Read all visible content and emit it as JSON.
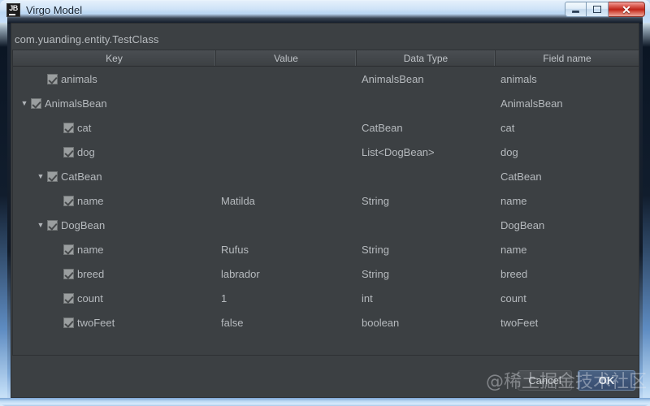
{
  "window": {
    "title": "Virgo Model",
    "app_icon": "jetbrains-jb-icon",
    "controls": {
      "minimize": "minimize-icon",
      "maximize": "maximize-icon",
      "close_glyph": "✕"
    }
  },
  "dialog": {
    "class_name": "com.yuanding.entity.TestClass",
    "table": {
      "columns": [
        "Key",
        "Value",
        "Data Type",
        "Field name"
      ],
      "rows": [
        {
          "indent": 1,
          "toggle": "",
          "checked": true,
          "key": "animals",
          "value": "",
          "type": "AnimalsBean",
          "field": "animals"
        },
        {
          "indent": 0,
          "toggle": "▼",
          "checked": true,
          "key": "AnimalsBean",
          "value": "",
          "type": "",
          "field": "AnimalsBean"
        },
        {
          "indent": 2,
          "toggle": "",
          "checked": true,
          "key": "cat",
          "value": "",
          "type": "CatBean",
          "field": "cat"
        },
        {
          "indent": 2,
          "toggle": "",
          "checked": true,
          "key": "dog",
          "value": "",
          "type": "List<DogBean>",
          "field": "dog"
        },
        {
          "indent": 1,
          "toggle": "▼",
          "checked": true,
          "key": "CatBean",
          "value": "",
          "type": "",
          "field": "CatBean"
        },
        {
          "indent": 2,
          "toggle": "",
          "checked": true,
          "key": "name",
          "value": "Matilda",
          "type": "String",
          "field": "name"
        },
        {
          "indent": 1,
          "toggle": "▼",
          "checked": true,
          "key": "DogBean",
          "value": "",
          "type": "",
          "field": "DogBean"
        },
        {
          "indent": 2,
          "toggle": "",
          "checked": true,
          "key": "name",
          "value": "Rufus",
          "type": "String",
          "field": "name"
        },
        {
          "indent": 2,
          "toggle": "",
          "checked": true,
          "key": "breed",
          "value": "labrador",
          "type": "String",
          "field": "breed"
        },
        {
          "indent": 2,
          "toggle": "",
          "checked": true,
          "key": "count",
          "value": "1",
          "type": "int",
          "field": "count"
        },
        {
          "indent": 2,
          "toggle": "",
          "checked": true,
          "key": "twoFeet",
          "value": "false",
          "type": "boolean",
          "field": "twoFeet"
        }
      ]
    },
    "buttons": {
      "cancel": "Cancel",
      "ok": "OK"
    }
  },
  "watermark": "@稀土掘金技术社区",
  "colors": {
    "titlebar": "#c3dcf5",
    "dialog_bg": "#3c4043",
    "text": "#b6babe",
    "close_button": "#bf2419",
    "ok_button": "#3f567a"
  }
}
